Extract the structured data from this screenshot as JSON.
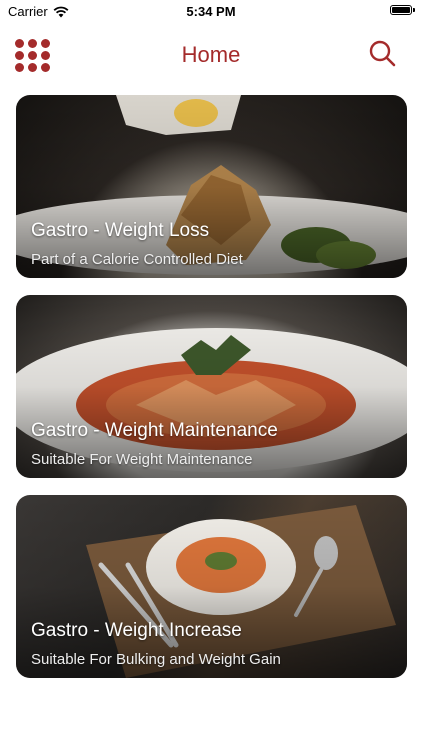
{
  "status_bar": {
    "carrier": "Carrier",
    "time": "5:34 PM"
  },
  "nav": {
    "title": "Home",
    "menu_icon": "grid-menu-icon",
    "search_icon": "search-icon"
  },
  "theme": {
    "accent": "#a42b2b"
  },
  "cards": [
    {
      "title": "Gastro - Weight Loss",
      "subtitle": "Part of a Calorie Controlled Diet"
    },
    {
      "title": "Gastro - Weight Maintenance",
      "subtitle": "Suitable For Weight Maintenance"
    },
    {
      "title": "Gastro - Weight Increase",
      "subtitle": "Suitable For Bulking and Weight Gain"
    }
  ]
}
